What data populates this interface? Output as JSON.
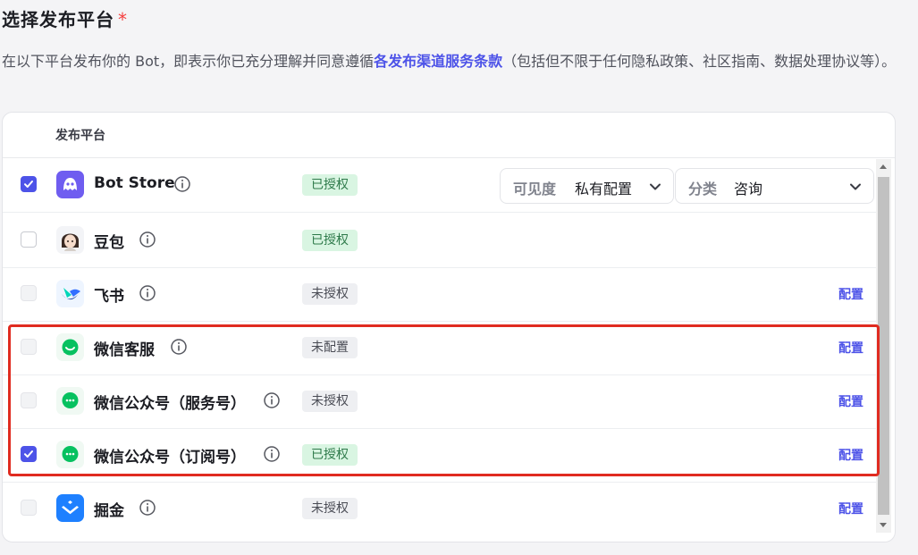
{
  "header": {
    "title": "选择发布平台",
    "required_mark": "*",
    "desc_before": "在以下平台发布你的 Bot，即表示你已充分理解并同意遵循",
    "desc_link": "各发布渠道服务条款",
    "desc_after": "（包括但不限于任何隐私政策、社区指南、数据处理协议等）。"
  },
  "table": {
    "column_header": "发布平台",
    "rows": [
      {
        "name": "Bot Store",
        "status": "已授权",
        "checked": true,
        "icon": "bot-store-icon"
      },
      {
        "name": "豆包",
        "status": "已授权",
        "checked": false,
        "icon": "doubao-avatar-icon"
      },
      {
        "name": "飞书",
        "status": "未授权",
        "checked": false,
        "action": "配置",
        "icon": "feishu-icon"
      },
      {
        "name": "微信客服",
        "status": "未配置",
        "checked": false,
        "action": "配置",
        "icon": "wechat-service-icon"
      },
      {
        "name": "微信公众号（服务号）",
        "status": "未授权",
        "checked": false,
        "action": "配置",
        "icon": "wechat-official-icon"
      },
      {
        "name": "微信公众号（订阅号）",
        "status": "已授权",
        "checked": true,
        "action": "配置",
        "icon": "wechat-subscription-icon"
      },
      {
        "name": "掘金",
        "status": "未授权",
        "checked": false,
        "action": "配置",
        "icon": "juejin-icon"
      }
    ]
  },
  "bot_store_options": {
    "visibility_label": "可见度",
    "visibility_value": "私有配置",
    "category_label": "分类",
    "category_value": "咨询"
  },
  "colors": {
    "accent": "#4d53e8",
    "authorized_bg": "#d9f5e2",
    "highlight": "#e02b20"
  }
}
